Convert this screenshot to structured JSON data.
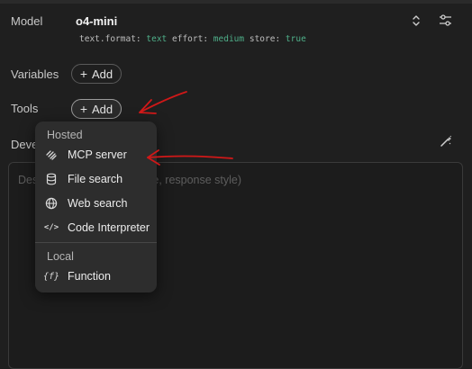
{
  "model": {
    "label": "Model",
    "name": "o4-mini",
    "params": [
      {
        "key": "text.format:",
        "value": "text"
      },
      {
        "key": "effort:",
        "value": "medium"
      },
      {
        "key": "store:",
        "value": "true"
      }
    ]
  },
  "variables": {
    "label": "Variables",
    "add_label": "Add"
  },
  "tools": {
    "label": "Tools",
    "add_label": "Add"
  },
  "developer": {
    "label": "Deve",
    "placeholder": "Des...avior (tone, tool usage, response style)"
  },
  "menu": {
    "hosted_label": "Hosted",
    "hosted_items": [
      "MCP server",
      "File search",
      "Web search",
      "Code Interpreter"
    ],
    "local_label": "Local",
    "local_items": [
      "Function"
    ]
  },
  "colors": {
    "annotation": "#d01818",
    "param_value": "#4fb08a"
  },
  "icons": {
    "model_select": "chevron-up-down-icon",
    "model_settings": "sliders-icon",
    "developer_edit": "magic-wand-icon",
    "menu": [
      "mcp-icon",
      "database-icon",
      "globe-icon",
      "code-icon",
      "function-icon"
    ]
  }
}
